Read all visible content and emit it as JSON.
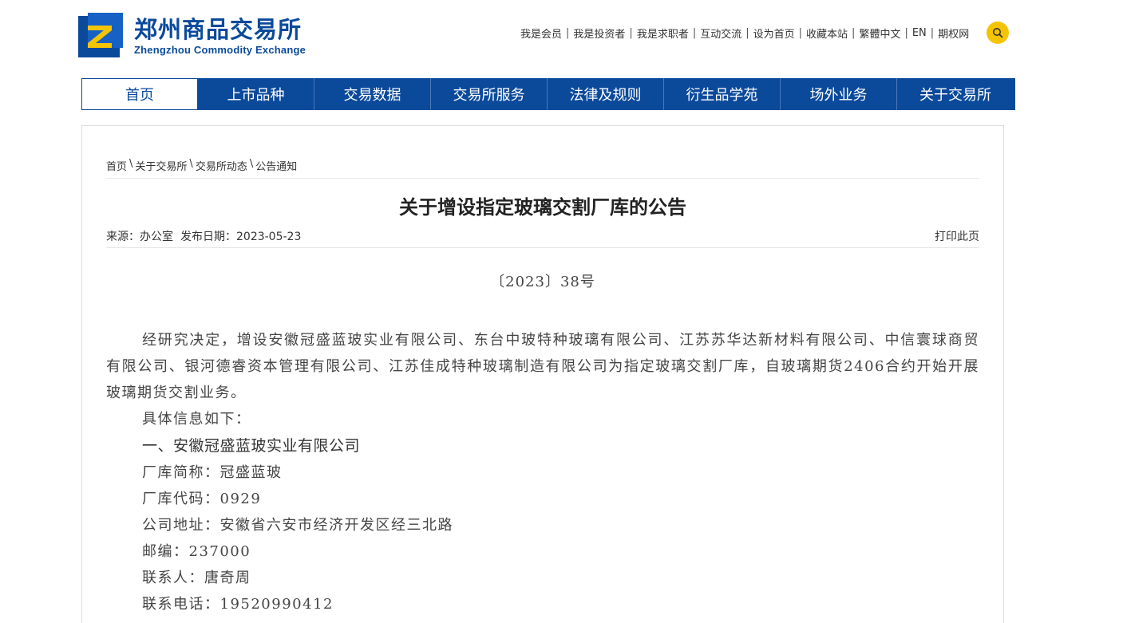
{
  "header": {
    "logo_cn": "郑州商品交易所",
    "logo_en": "Zhengzhou Commodity Exchange",
    "brand_color": "#0b4a9b",
    "links": [
      "我是会员",
      "我是投资者",
      "我是求职者",
      "互动交流",
      "设为首页",
      "收藏本站",
      "繁體中文",
      "EN",
      "期权网"
    ],
    "search_icon": "search-icon",
    "search_color": "#f5c400"
  },
  "nav": {
    "items": [
      "首页",
      "上市品种",
      "交易数据",
      "交易所服务",
      "法律及规则",
      "衍生品学苑",
      "场外业务",
      "关于交易所"
    ],
    "active_index": 0
  },
  "breadcrumb": [
    "首页",
    "关于交易所",
    "交易所动态",
    "公告通知"
  ],
  "article": {
    "title": "关于增设指定玻璃交割厂库的公告",
    "source": "来源：办公室",
    "date": "发布日期：2023-05-23",
    "print_label": "打印此页",
    "doc_number": "〔2023〕38号",
    "paragraph": "经研究决定，增设安徽冠盛蓝玻实业有限公司、东台中玻特种玻璃有限公司、江苏苏华达新材料有限公司、中信寰球商贸有限公司、银河德睿资本管理有限公司、江苏佳成特种玻璃制造有限公司为指定玻璃交割厂库，自玻璃期货2406合约开始开展玻璃期货交割业务。",
    "intro": "具体信息如下：",
    "section1_title": "一、安徽冠盛蓝玻实业有限公司",
    "section1_lines": [
      "厂库简称：冠盛蓝玻",
      "厂库代码：0929",
      "公司地址：安徽省六安市经济开发区经三北路",
      "邮编：237000",
      "联系人：唐奇周",
      "联系电话：19520990412"
    ]
  }
}
